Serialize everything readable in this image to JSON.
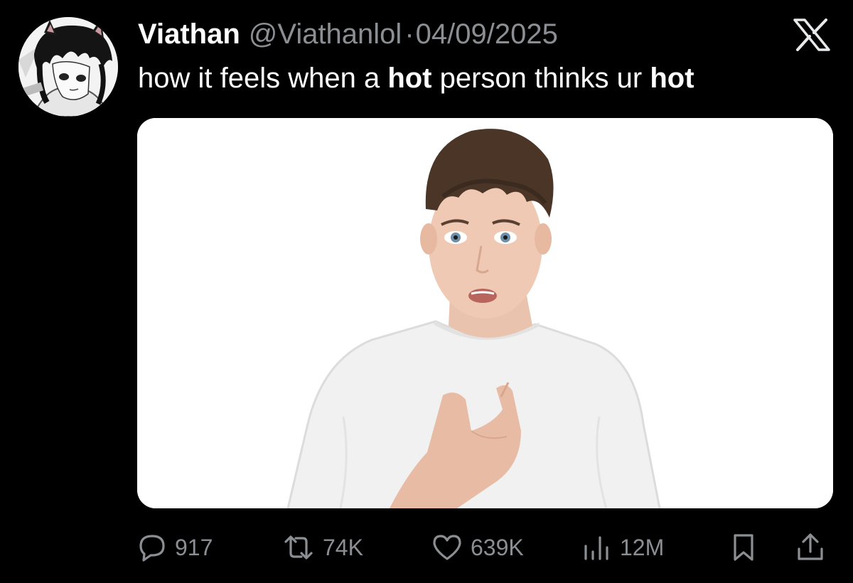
{
  "tweet": {
    "author": {
      "display_name": "Viathan",
      "handle": "@Viathanlol",
      "separator": "·",
      "avatar_icon": "anime-avatar"
    },
    "date": "04/09/2025",
    "platform_icon": "x-logo-icon",
    "text_parts": [
      {
        "text": "how it feels when a ",
        "bold": false
      },
      {
        "text": "hot",
        "bold": true
      },
      {
        "text": " person thinks ur ",
        "bold": false
      },
      {
        "text": "hot",
        "bold": true
      }
    ],
    "media": {
      "kind": "photo",
      "subject_icon": "person-pointing-at-self"
    },
    "stats": {
      "replies": "917",
      "retweets": "74K",
      "likes": "639K",
      "views": "12M"
    }
  },
  "colors": {
    "background": "#000000",
    "primary_text": "#ffffff",
    "secondary_text": "#8b8f93",
    "media_background": "#ffffff"
  }
}
